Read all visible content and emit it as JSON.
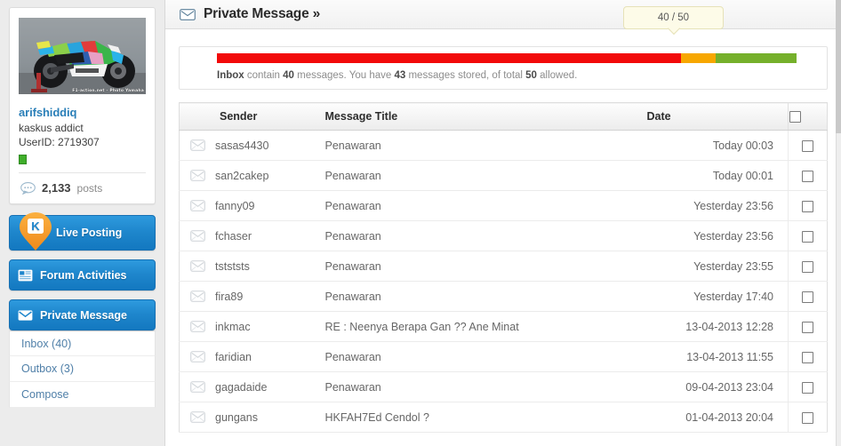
{
  "sidebar": {
    "profile": {
      "avatar_icon": "motorcycle-avatar-image",
      "avatar_credit": "F1-action.net - Photo Yamaha",
      "username": "arifshiddiq",
      "user_title": "kaskus addict",
      "user_id_label": "UserID: 2719307",
      "status_icon": "online-status-indicator",
      "posts_icon": "speech-bubble-icon",
      "posts_count": "2,133",
      "posts_label": "posts"
    },
    "nav": [
      {
        "label": "Live Posting",
        "icon": "kaskus-pin-icon"
      },
      {
        "label": "Forum Activities",
        "icon": "calendar-icon"
      },
      {
        "label": "Private Message",
        "icon": "envelope-icon"
      }
    ],
    "submenu": [
      {
        "label": "Inbox (40)"
      },
      {
        "label": "Outbox (3)"
      },
      {
        "label": "Compose"
      }
    ]
  },
  "header": {
    "icon": "envelope-icon",
    "title": "Private Message »"
  },
  "quota": {
    "tooltip": "40 / 50",
    "text_parts": {
      "p1": "Inbox",
      "p2": " contain ",
      "p3": "40",
      "p4": " messages. You have ",
      "p5": "43",
      "p6": " messages stored, of total ",
      "p7": "50",
      "p8": " allowed."
    },
    "segments": [
      {
        "name": "used",
        "color": "#f20a0a",
        "percent": 80
      },
      {
        "name": "warning",
        "color": "#f7a700",
        "percent": 6
      },
      {
        "name": "free",
        "color": "#75b02b",
        "percent": 14
      }
    ],
    "used": 40,
    "stored": 43,
    "total": 50
  },
  "table": {
    "columns": {
      "sender": "Sender",
      "title": "Message Title",
      "date": "Date",
      "select_all_icon": "checkbox-unchecked"
    },
    "rows": [
      {
        "icon": "envelope-icon",
        "sender": "sasas4430",
        "title": "Penawaran",
        "date": "Today 00:03"
      },
      {
        "icon": "envelope-icon",
        "sender": "san2cakep",
        "title": "Penawaran",
        "date": "Today 00:01"
      },
      {
        "icon": "envelope-icon",
        "sender": "fanny09",
        "title": "Penawaran",
        "date": "Yesterday 23:56"
      },
      {
        "icon": "envelope-icon",
        "sender": "fchaser",
        "title": "Penawaran",
        "date": "Yesterday 23:56"
      },
      {
        "icon": "envelope-icon",
        "sender": "tstststs",
        "title": "Penawaran",
        "date": "Yesterday 23:55"
      },
      {
        "icon": "envelope-icon",
        "sender": "fira89",
        "title": "Penawaran",
        "date": "Yesterday 17:40"
      },
      {
        "icon": "envelope-icon",
        "sender": "inkmac",
        "title": "RE : Neenya Berapa Gan ?? Ane Minat",
        "date": "13-04-2013 12:28"
      },
      {
        "icon": "envelope-icon",
        "sender": "faridian",
        "title": "Penawaran",
        "date": "13-04-2013 11:55"
      },
      {
        "icon": "envelope-icon",
        "sender": "gagadaide",
        "title": "Penawaran",
        "date": "09-04-2013 23:04"
      },
      {
        "icon": "envelope-icon",
        "sender": "gungans",
        "title": "HKFAH7Ed Cendol ?",
        "date": "01-04-2013 20:04"
      }
    ]
  },
  "colors": {
    "accent_blue": "#1e86cc",
    "link_blue": "#2a7fb8",
    "quota_red": "#f20a0a",
    "quota_amber": "#f7a700",
    "quota_green": "#75b02b",
    "status_green": "#3fae2a"
  }
}
